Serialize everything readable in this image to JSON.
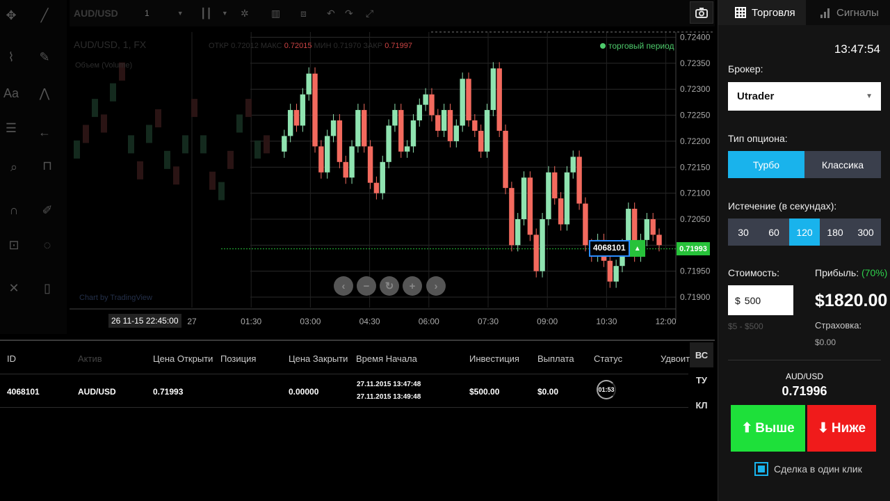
{
  "toolbar": {
    "symbol": "AUD/USD",
    "interval": "1"
  },
  "chart_header": {
    "title": "AUD/USD, 1, FX",
    "ohlc_prefix": "ОТКР 0.72012 МАКС",
    "ohlc_high": "0.72015",
    "ohlc_mid": "МИН 0.71970 ЗАКР",
    "ohlc_close": "0.71997",
    "study": "Объем (Volume)",
    "trading_period": "торговый период",
    "powered_by": "Chart by TradingView"
  },
  "chart_data": {
    "type": "candlestick",
    "symbol": "AUD/USD",
    "x_ticks": [
      "27",
      "01:30",
      "03:00",
      "04:30",
      "06:00",
      "07:30",
      "09:00",
      "10:30",
      "12:00"
    ],
    "y_ticks": [
      "0.72400",
      "0.72350",
      "0.72300",
      "0.72250",
      "0.72200",
      "0.72150",
      "0.72100",
      "0.72050",
      "0.72000",
      "0.71950",
      "0.71900"
    ],
    "ylim": [
      0.7188,
      0.7241
    ],
    "current_price": "0.71993",
    "crosshair_time": "26 11-15 22:45:00",
    "trade_marker_id": "4068101",
    "series": [
      {
        "name": "",
        "values": [
          0.7218,
          0.7221,
          0.7226,
          0.7223,
          0.7229,
          0.7233,
          0.7219,
          0.7214,
          0.7221,
          0.7224,
          0.7216,
          0.7213,
          0.7219,
          0.7226,
          0.7219,
          0.7212,
          0.721,
          0.7216,
          0.7223,
          0.7226,
          0.7218,
          0.7219,
          0.7224,
          0.7227,
          0.7229,
          0.7225,
          0.7222,
          0.7226,
          0.722,
          0.7223,
          0.7232,
          0.7224,
          0.7222,
          0.7218,
          0.7226,
          0.7234,
          0.7222,
          0.7211,
          0.72,
          0.7205,
          0.7213,
          0.7202,
          0.7195,
          0.7205,
          0.7214,
          0.7209,
          0.7204,
          0.7214,
          0.7217,
          0.7208,
          0.72,
          0.7198,
          0.7201,
          0.7197,
          0.7193,
          0.7196,
          0.72,
          0.7207,
          0.7198,
          0.7201,
          0.7205,
          0.7202,
          0.72
        ]
      }
    ]
  },
  "nav_buttons": [
    "‹",
    "−",
    "↻",
    "+",
    "›"
  ],
  "table": {
    "headers": [
      "ID",
      "Актив",
      "Цена Открыти",
      "Позиция",
      "Цена Закрыти",
      "Время Начала",
      "Инвестиция",
      "Выплата",
      "Статус",
      "Удвоит"
    ],
    "row": {
      "id": "4068101",
      "asset": "AUD/USD",
      "open_price": "0.71993",
      "close_price": "0.00000",
      "start_time": "27.11.2015 13:47:48",
      "end_time": "27.11.2015 13:49:48",
      "investment": "$500.00",
      "payout": "$0.00",
      "status_timer": "01:53"
    },
    "side_tabs": [
      "ВС",
      "ТУ",
      "КЛ"
    ]
  },
  "panel": {
    "tab_trading": "Торговля",
    "tab_signals": "Сигналы",
    "clock": "13:47:54",
    "broker_label": "Брокер:",
    "broker_value": "Utrader",
    "option_type_label": "Тип опциона:",
    "option_turbo": "Турбо",
    "option_classic": "Классика",
    "expiry_label": "Истечение (в секундах):",
    "expiry_options": [
      "30",
      "60",
      "120",
      "180",
      "300"
    ],
    "expiry_selected": "120",
    "cost_label": "Стоимость:",
    "cost_currency": "$",
    "cost_value": "500",
    "cost_range": "$5 - $500",
    "profit_label": "Прибыль:",
    "profit_pct": "(70%)",
    "profit_amount": "$1820.00",
    "insurance_label": "Страховка:",
    "insurance_value": "$0.00",
    "asset": "AUD/USD",
    "asset_price": "0.71996",
    "btn_up": "Выше",
    "btn_down": "Ниже",
    "one_click": "Сделка в один клик",
    "colors": {
      "accent": "#19b3ec",
      "up": "#1ee03a",
      "down": "#f01b1b",
      "bull": "#8fe3b0",
      "bear": "#f36a5e"
    }
  }
}
